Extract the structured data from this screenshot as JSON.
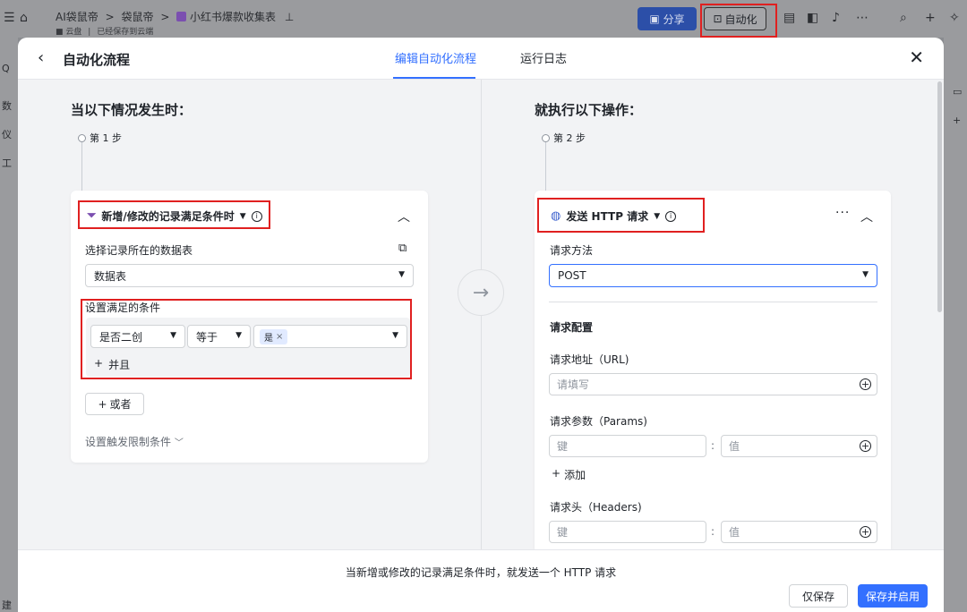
{
  "background": {
    "breadcrumb": [
      "AI袋鼠帝",
      "袋鼠帝",
      "小红书爆款收集表"
    ],
    "breadcrumb_sep": ">",
    "sub": [
      "云盘",
      "已经保存到云端"
    ],
    "share_label": "分享",
    "automation_label": "自动化",
    "left_items": [
      "数",
      "仪",
      "工",
      "建"
    ],
    "left_search": "Q"
  },
  "modal": {
    "title": "自动化流程",
    "tabs": [
      {
        "label": "编辑自动化流程",
        "active": true
      },
      {
        "label": "运行日志",
        "active": false
      }
    ]
  },
  "trigger": {
    "section_title": "当以下情况发生时：",
    "step": "第 1 步",
    "name": "新增/修改的记录满足条件时",
    "table_label": "选择记录所在的数据表",
    "table_value": "数据表",
    "condition_label": "设置满足的条件",
    "condition": {
      "field": "是否二创",
      "operator": "等于",
      "value_tag": "是"
    },
    "add_and": "并且",
    "add_or": "或者",
    "limit_label": "设置触发限制条件"
  },
  "action": {
    "section_title": "就执行以下操作：",
    "step": "第 2 步",
    "name": "发送 HTTP 请求",
    "method_label": "请求方法",
    "method_value": "POST",
    "config_title": "请求配置",
    "url_label": "请求地址（URL)",
    "url_placeholder": "请填写",
    "params_label": "请求参数（Params)",
    "headers_label": "请求头（Headers)",
    "key_placeholder": "键",
    "value_placeholder": "值",
    "colon": ":",
    "add_label": "添加"
  },
  "footer": {
    "summary": "当新增或修改的记录满足条件时，就发送一个 HTTP 请求",
    "save_only": "仅保存",
    "save_enable": "保存并启用"
  },
  "colors": {
    "accent": "#3370ff",
    "highlight": "#e02020"
  }
}
